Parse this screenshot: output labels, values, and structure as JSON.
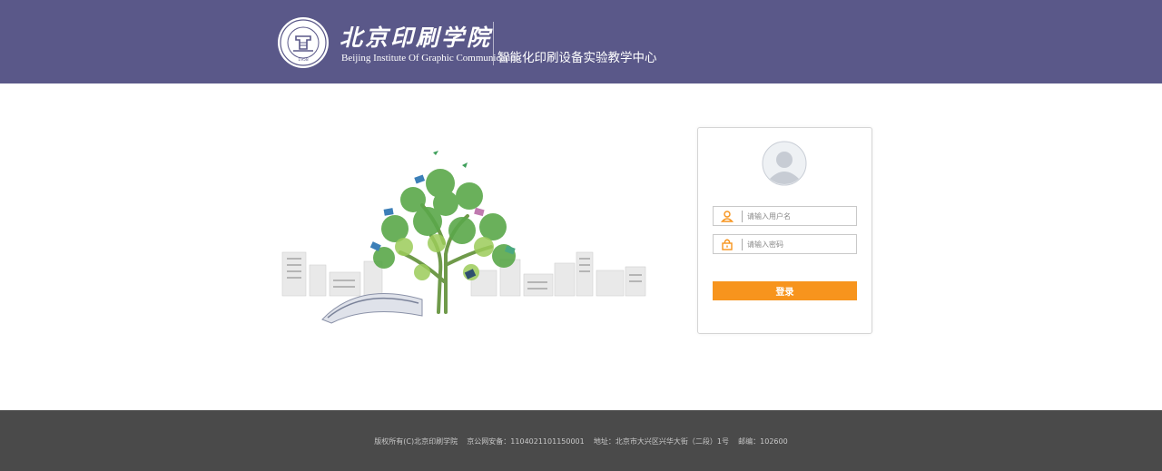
{
  "header": {
    "school_name_cn": "北京印刷学院",
    "school_name_en": "Beijing Institute Of Graphic Communication",
    "center_name": "智能化印刷设备实验教学中心",
    "seal_text": "1958",
    "bg_color": "#5a5889"
  },
  "login": {
    "username_placeholder": "请输入用户名",
    "password_placeholder": "请输入密码",
    "submit_label": "登录",
    "accent_color": "#f7941d",
    "icons": {
      "user": "user-icon",
      "lock": "lock-icon",
      "avatar": "avatar-icon"
    }
  },
  "footer": {
    "text": "版权所有(C)北京印刷学院    京公网安备：1104021101150001    地址：北京市大兴区兴华大街（二段）1号    邮编：102600"
  }
}
